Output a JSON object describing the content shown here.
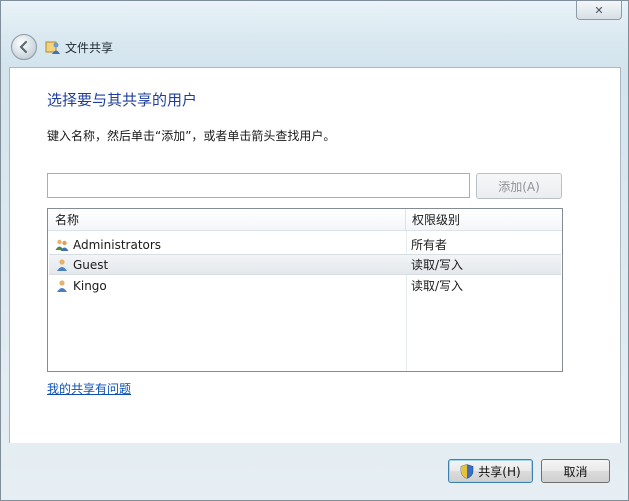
{
  "window": {
    "title": "文件共享",
    "close_label": "✕"
  },
  "dialog": {
    "heading": "选择要与其共享的用户",
    "instruction": "键入名称，然后单击“添加”，或者单击箭头查找用户。",
    "name_input": {
      "value": "",
      "placeholder": ""
    },
    "add_button": "添加(A)",
    "columns": {
      "name": "名称",
      "permission": "权限级别"
    },
    "rows": [
      {
        "name": "Administrators",
        "permission": "所有者",
        "icon": "group-icon"
      },
      {
        "name": "Guest",
        "permission": "读取/写入",
        "icon": "user-icon",
        "selected": true
      },
      {
        "name": "Kingo",
        "permission": "读取/写入",
        "icon": "user-icon"
      }
    ],
    "help_link": "我的共享有问题"
  },
  "footer": {
    "share_button": "共享(H)",
    "cancel_button": "取消"
  },
  "colors": {
    "heading": "#1e3f9e",
    "link": "#0d4fb3",
    "selected_row": "#e4e8ec"
  }
}
